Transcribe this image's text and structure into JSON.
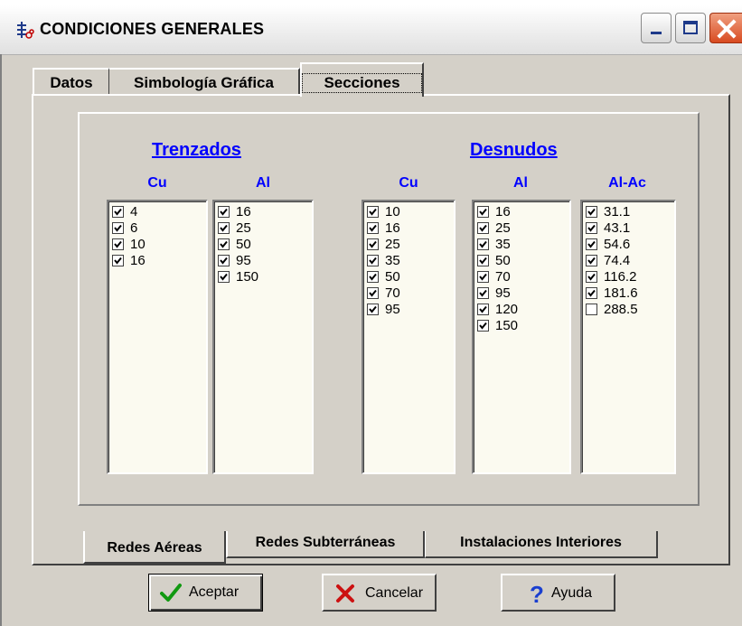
{
  "window": {
    "title": "CONDICIONES GENERALES",
    "icon": "app-symbol-icon"
  },
  "tabs": [
    {
      "label": "Datos",
      "active": false
    },
    {
      "label": "Simbología Gráfica",
      "active": false
    },
    {
      "label": "Secciones",
      "active": true
    }
  ],
  "groups": {
    "trenzados": {
      "title": "Trenzados",
      "columns": [
        {
          "title": "Cu",
          "items": [
            {
              "label": "4",
              "checked": true
            },
            {
              "label": "6",
              "checked": true
            },
            {
              "label": "10",
              "checked": true
            },
            {
              "label": "16",
              "checked": true
            }
          ]
        },
        {
          "title": "Al",
          "items": [
            {
              "label": "16",
              "checked": true
            },
            {
              "label": "25",
              "checked": true
            },
            {
              "label": "50",
              "checked": true
            },
            {
              "label": "95",
              "checked": true
            },
            {
              "label": "150",
              "checked": true
            }
          ]
        }
      ]
    },
    "desnudos": {
      "title": "Desnudos",
      "columns": [
        {
          "title": "Cu",
          "items": [
            {
              "label": "10",
              "checked": true
            },
            {
              "label": "16",
              "checked": true
            },
            {
              "label": "25",
              "checked": true
            },
            {
              "label": "35",
              "checked": true
            },
            {
              "label": "50",
              "checked": true
            },
            {
              "label": "70",
              "checked": true
            },
            {
              "label": "95",
              "checked": true
            }
          ]
        },
        {
          "title": "Al",
          "items": [
            {
              "label": "16",
              "checked": true
            },
            {
              "label": "25",
              "checked": true
            },
            {
              "label": "35",
              "checked": true
            },
            {
              "label": "50",
              "checked": true
            },
            {
              "label": "70",
              "checked": true
            },
            {
              "label": "95",
              "checked": true
            },
            {
              "label": "120",
              "checked": true
            },
            {
              "label": "150",
              "checked": true
            }
          ]
        },
        {
          "title": "Al-Ac",
          "items": [
            {
              "label": "31.1",
              "checked": true
            },
            {
              "label": "43.1",
              "checked": true
            },
            {
              "label": "54.6",
              "checked": true
            },
            {
              "label": "74.4",
              "checked": true
            },
            {
              "label": "116.2",
              "checked": true
            },
            {
              "label": "181.6",
              "checked": true
            },
            {
              "label": "288.5",
              "checked": false
            }
          ]
        }
      ]
    }
  },
  "subtabs": [
    {
      "label": "Redes Aéreas",
      "active": true
    },
    {
      "label": "Redes Subterráneas",
      "active": false
    },
    {
      "label": "Instalaciones Interiores",
      "active": false
    }
  ],
  "buttons": {
    "accept": {
      "label": "Aceptar",
      "icon": "checkmark-icon"
    },
    "cancel": {
      "label": "Cancelar",
      "icon": "x-icon"
    },
    "help": {
      "label": "Ayuda",
      "icon": "question-icon"
    }
  },
  "colors": {
    "heading_blue": "#0000ff",
    "list_background": "#fbfaf0",
    "dialog_background": "#d4d0c8"
  }
}
